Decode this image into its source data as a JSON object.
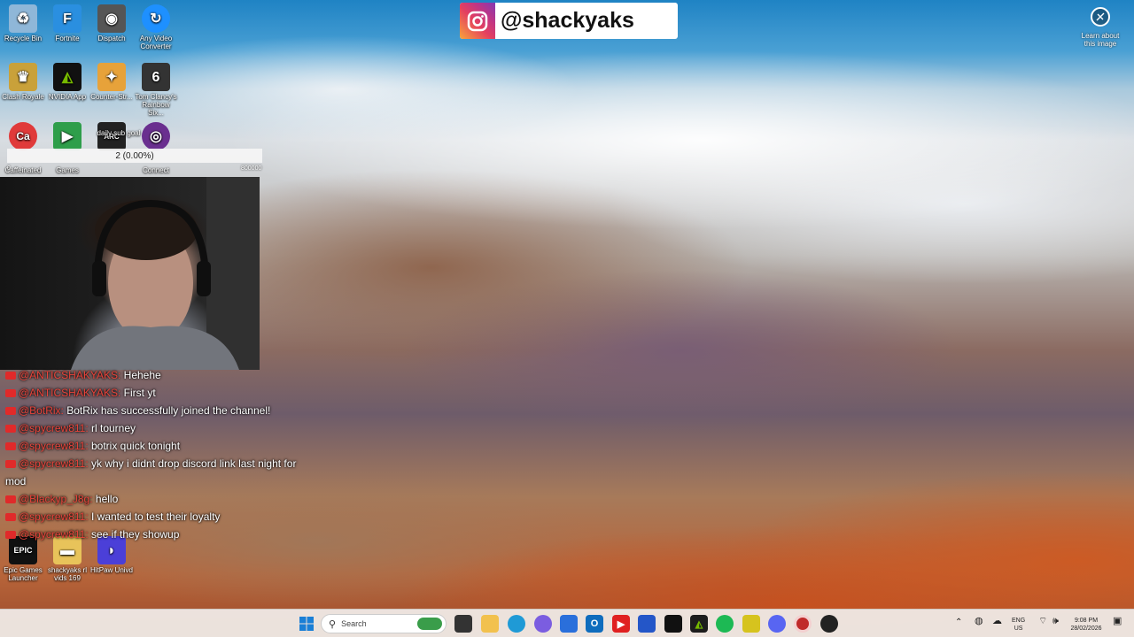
{
  "desktop": {
    "icons": [
      {
        "label": "Recycle Bin",
        "glyph": "♻",
        "color": "#8fb7d8"
      },
      {
        "label": "Fortnite",
        "glyph": "F",
        "color": "#2a8fe0"
      },
      {
        "label": "Dispatch",
        "glyph": "◉",
        "color": "#555555"
      },
      {
        "label": "Any Video Converter",
        "glyph": "↻",
        "color": "#1e90ff"
      },
      {
        "label": "Clash Royale",
        "glyph": "♛",
        "color": "#c9a13a"
      },
      {
        "label": "NVIDIA App",
        "glyph": "◭",
        "color": "#76b900"
      },
      {
        "label": "Counter-Str...",
        "glyph": "✦",
        "color": "#e7a23a"
      },
      {
        "label": "Tom Clancy's Rainbow Six...",
        "glyph": "6",
        "color": "#333333"
      },
      {
        "label": "Caffeinated",
        "glyph": "Ca",
        "color": "#e03a3a"
      },
      {
        "label": "Games",
        "glyph": "▶",
        "color": "#2e9e4a"
      },
      {
        "label": "daily sub goal",
        "glyph": "ARC",
        "color": "#222222"
      },
      {
        "label": "Connect",
        "glyph": "◎",
        "color": "#6a2f8f"
      },
      {
        "label": "Epic Games Launcher",
        "glyph": "EPIC",
        "color": "#111111"
      },
      {
        "label": "shackyaks rl vids 169",
        "glyph": "▬",
        "color": "#e8c35a"
      },
      {
        "label": "HitPaw Univd",
        "glyph": "◗",
        "color": "#4b3fd8"
      }
    ]
  },
  "instagram": {
    "handle": "@shackyaks"
  },
  "learn_about": {
    "label": "Learn about this image"
  },
  "sub_goal": {
    "text": "2 (0.00%)",
    "start": "0",
    "end": "800000",
    "progress": 0.0
  },
  "chat": [
    {
      "user": "@ANTICSHAKYAKS:",
      "text": "Hehehe"
    },
    {
      "user": "@ANTICSHAKYAKS:",
      "text": "First yt"
    },
    {
      "user": "@BotRix:",
      "text": "BotRix has successfully joined the channel!"
    },
    {
      "user": "@spycrew811:",
      "text": "rl tourney"
    },
    {
      "user": "@spycrew811:",
      "text": "botrix quick tonight"
    },
    {
      "user": "@spycrew811:",
      "text": "yk why i didnt drop discord link last night for mod"
    },
    {
      "user": "@Blackyp_J8g:",
      "text": "hello"
    },
    {
      "user": "@spycrew811:",
      "text": "I wanted to test their loyalty"
    },
    {
      "user": "@spycrew811:",
      "text": "see if they showup"
    }
  ],
  "taskbar": {
    "search_placeholder": "Search",
    "lang_line1": "ENG",
    "lang_line2": "US",
    "time": "9:08 PM",
    "date": "28/02/2026"
  }
}
